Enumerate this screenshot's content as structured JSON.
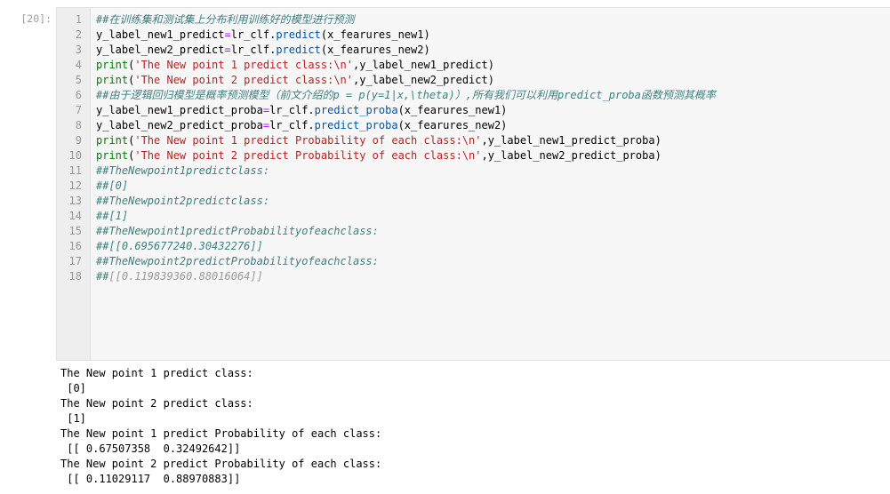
{
  "cell": {
    "prompt": "[20]:",
    "code_lines": [
      {
        "n": "1",
        "tokens": [
          [
            "comment",
            "##在训练集和测试集上分布利用训练好的模型进行预测"
          ]
        ]
      },
      {
        "n": "2",
        "tokens": [
          [
            "default",
            "y_label_new1_predict"
          ],
          [
            "op",
            "="
          ],
          [
            "default",
            "lr_clf."
          ],
          [
            "method",
            "predict"
          ],
          [
            "default",
            "(x_fearures_new1)"
          ]
        ]
      },
      {
        "n": "3",
        "tokens": [
          [
            "default",
            "y_label_new2_predict"
          ],
          [
            "op",
            "="
          ],
          [
            "default",
            "lr_clf."
          ],
          [
            "method",
            "predict"
          ],
          [
            "default",
            "(x_fearures_new2)"
          ]
        ]
      },
      {
        "n": "4",
        "tokens": [
          [
            "builtin",
            "print"
          ],
          [
            "default",
            "("
          ],
          [
            "string",
            "'The New point 1 predict class:\\n'"
          ],
          [
            "default",
            ",y_label_new1_predict)"
          ]
        ]
      },
      {
        "n": "5",
        "tokens": [
          [
            "builtin",
            "print"
          ],
          [
            "default",
            "("
          ],
          [
            "string",
            "'The New point 2 predict class:\\n'"
          ],
          [
            "default",
            ",y_label_new2_predict)"
          ]
        ]
      },
      {
        "n": "6",
        "tokens": [
          [
            "comment",
            "##由于逻辑回归模型是概率预测模型（前文介绍的p = p(y=1|x,\\theta)）,所有我们可以利用predict_proba函数预测其概率"
          ]
        ]
      },
      {
        "n": "7",
        "tokens": [
          [
            "default",
            "y_label_new1_predict_proba"
          ],
          [
            "op",
            "="
          ],
          [
            "default",
            "lr_clf."
          ],
          [
            "method",
            "predict_proba"
          ],
          [
            "default",
            "(x_fearures_new1)"
          ]
        ]
      },
      {
        "n": "8",
        "tokens": [
          [
            "default",
            "y_label_new2_predict_proba"
          ],
          [
            "op",
            "="
          ],
          [
            "default",
            "lr_clf."
          ],
          [
            "method",
            "predict_proba"
          ],
          [
            "default",
            "(x_fearures_new2)"
          ]
        ]
      },
      {
        "n": "9",
        "tokens": [
          [
            "builtin",
            "print"
          ],
          [
            "default",
            "("
          ],
          [
            "string",
            "'The New point 1 predict Probability of each class:\\n'"
          ],
          [
            "default",
            ",y_label_new1_predict_proba)"
          ]
        ]
      },
      {
        "n": "10",
        "tokens": [
          [
            "builtin",
            "print"
          ],
          [
            "default",
            "("
          ],
          [
            "string",
            "'The New point 2 predict Probability of each class:\\n'"
          ],
          [
            "default",
            ",y_label_new2_predict_proba)"
          ]
        ]
      },
      {
        "n": "11",
        "tokens": [
          [
            "comment",
            "##TheNewpoint1predictclass:"
          ]
        ]
      },
      {
        "n": "12",
        "tokens": [
          [
            "comment",
            "##[0]"
          ]
        ]
      },
      {
        "n": "13",
        "tokens": [
          [
            "comment",
            "##TheNewpoint2predictclass:"
          ]
        ]
      },
      {
        "n": "14",
        "tokens": [
          [
            "comment",
            "##[1]"
          ]
        ]
      },
      {
        "n": "15",
        "tokens": [
          [
            "comment",
            "##TheNewpoint1predictProbabilityofeachclass:"
          ]
        ]
      },
      {
        "n": "16",
        "tokens": [
          [
            "comment",
            "##[[0.695677240.30432276]]"
          ]
        ]
      },
      {
        "n": "17",
        "tokens": [
          [
            "comment",
            "##TheNewpoint2predictProbabilityofeachclass:"
          ]
        ]
      },
      {
        "n": "18",
        "tokens": [
          [
            "comment",
            "##"
          ],
          [
            "bracket",
            "[[0.119839360.88016064]]"
          ]
        ]
      }
    ],
    "output_lines": [
      "The New point 1 predict class:",
      " [0]",
      "The New point 2 predict class:",
      " [1]",
      "The New point 1 predict Probability of each class:",
      " [[ 0.67507358  0.32492642]]",
      "The New point 2 predict Probability of each class:",
      " [[ 0.11029117  0.88970883]]"
    ]
  }
}
